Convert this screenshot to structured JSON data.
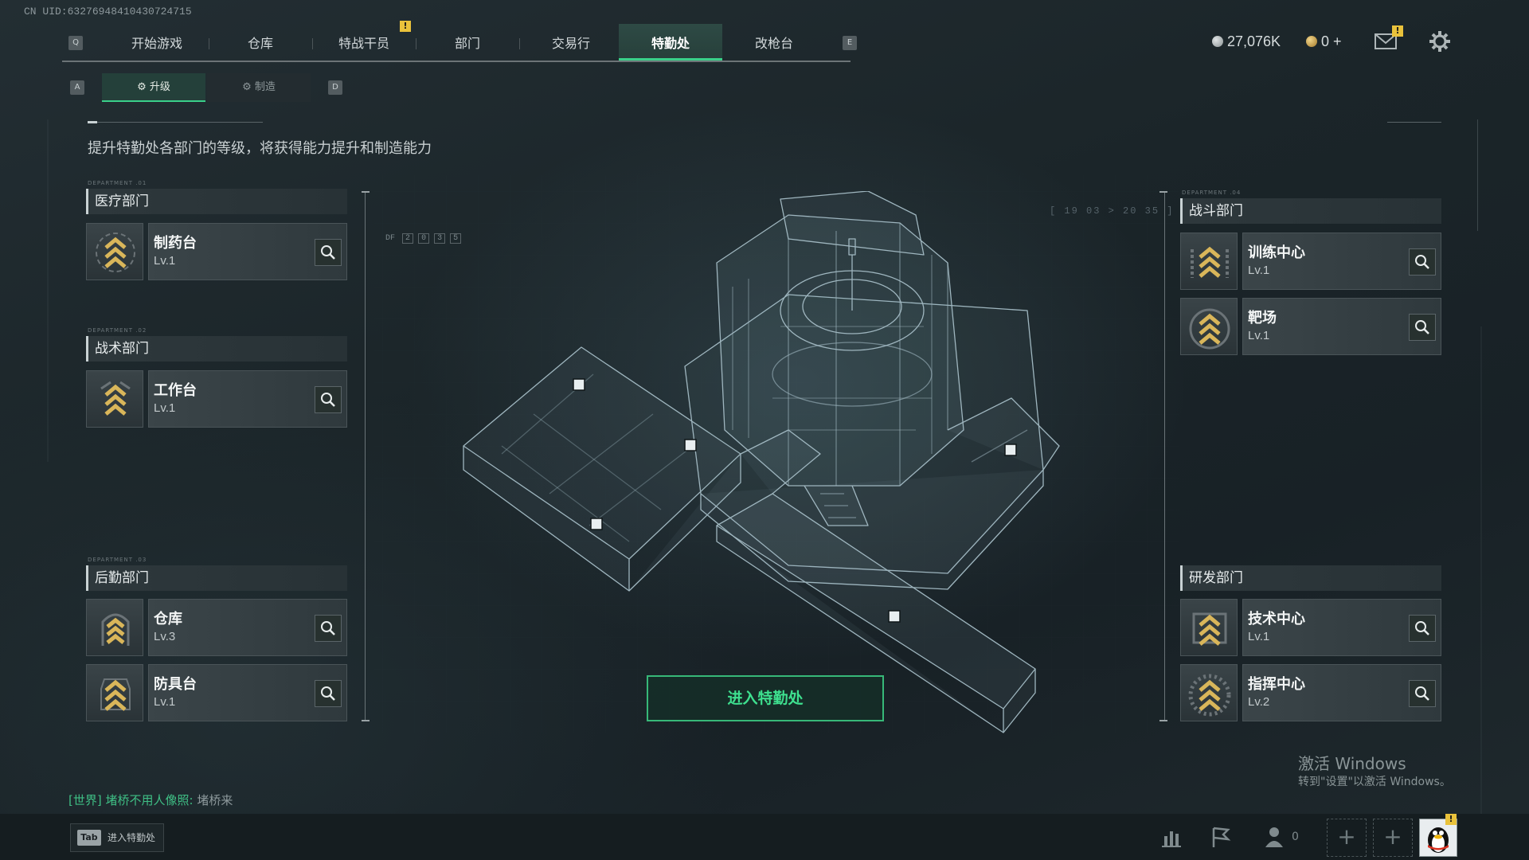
{
  "uid": "CN UID:63276948410430724715",
  "topnav": {
    "key_left": "Q",
    "key_right": "E",
    "tabs": [
      "开始游戏",
      "仓库",
      "特战干员",
      "部门",
      "交易行",
      "特勤处",
      "改枪台"
    ],
    "active": "特勤处",
    "alert_mark": "!"
  },
  "currency": {
    "silver": "27,076K",
    "gold": "0 +"
  },
  "subtabs": {
    "key_left": "A",
    "key_right": "D",
    "items": [
      "升级",
      "制造"
    ],
    "active": "升级"
  },
  "description": "提升特勤处各部门的等级，将获得能力提升和制造能力",
  "departments": {
    "medical": {
      "tag": "DEPARTMENT .01",
      "title": "医疗部门",
      "items": [
        {
          "name": "制药台",
          "level": "Lv.1"
        }
      ]
    },
    "tactical": {
      "tag": "DEPARTMENT .02",
      "title": "战术部门",
      "items": [
        {
          "name": "工作台",
          "level": "Lv.1"
        }
      ]
    },
    "logistics": {
      "tag": "DEPARTMENT .03",
      "title": "后勤部门",
      "items": [
        {
          "name": "仓库",
          "level": "Lv.3"
        },
        {
          "name": "防具台",
          "level": "Lv.1"
        }
      ]
    },
    "combat": {
      "tag": "DEPARTMENT .04",
      "title": "战斗部门",
      "items": [
        {
          "name": "训练中心",
          "level": "Lv.1"
        },
        {
          "name": "靶场",
          "level": "Lv.1"
        }
      ]
    },
    "research": {
      "title": "研发部门",
      "items": [
        {
          "name": "技术中心",
          "level": "Lv.1"
        },
        {
          "name": "指挥中心",
          "level": "Lv.2"
        }
      ]
    }
  },
  "enter_button": "进入特勤处",
  "chat": {
    "channel": "[世界]",
    "user": "堵桥不用人像照:",
    "message": "堵桥来"
  },
  "tab_hint": {
    "key": "Tab",
    "label": "进入特勤处"
  },
  "friends_count": "0",
  "hud": {
    "df_label": "DF",
    "df_code": [
      "2",
      "0",
      "3",
      "5"
    ],
    "coords": "[ 19 03 > 20 35 ]"
  },
  "windows": {
    "line1": "激活 Windows",
    "line2": "转到\"设置\"以激活 Windows。"
  },
  "colors": {
    "accent_green": "#3ad08a",
    "alert_yellow": "#e9c23b",
    "chevron_gold": "#d9b65a"
  }
}
